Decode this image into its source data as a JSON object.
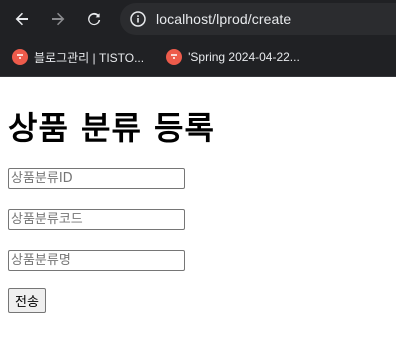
{
  "browser": {
    "url": "localhost/lprod/create",
    "bookmarks": [
      {
        "label": "블로그관리 | TISTO..."
      },
      {
        "label": "'Spring 2024-04-22..."
      }
    ]
  },
  "page": {
    "title": "상품 분류 등록",
    "fields": [
      {
        "placeholder": "상품분류ID",
        "value": ""
      },
      {
        "placeholder": "상품분류코드",
        "value": ""
      },
      {
        "placeholder": "상품분류명",
        "value": ""
      }
    ],
    "submit_label": "전송"
  },
  "colors": {
    "browser_bg": "#202124",
    "favicon": "#ed5b4b"
  }
}
